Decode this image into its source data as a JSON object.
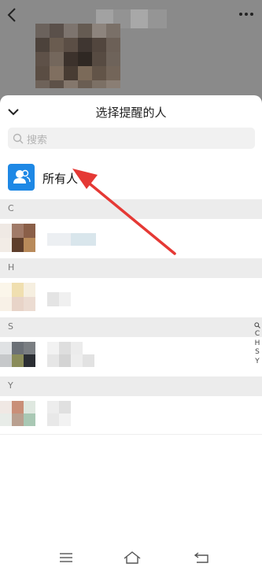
{
  "sheet": {
    "title": "选择提醒的人",
    "search_placeholder": "搜索",
    "everyone_label": "所有人"
  },
  "sections": [
    {
      "letter": "C"
    },
    {
      "letter": "H"
    },
    {
      "letter": "S"
    },
    {
      "letter": "Y"
    }
  ],
  "index_bar": [
    "C",
    "H",
    "S",
    "Y"
  ],
  "icons": {
    "back": "back-chevron-icon",
    "more": "more-dots-icon",
    "collapse": "chevron-down-icon",
    "search": "search-icon",
    "everyone": "group-contacts-icon",
    "nav_menu": "menu-icon",
    "nav_home": "home-icon",
    "nav_back": "back-icon"
  },
  "colors": {
    "accent": "#1e88e5",
    "annotation_arrow": "#e53935"
  }
}
